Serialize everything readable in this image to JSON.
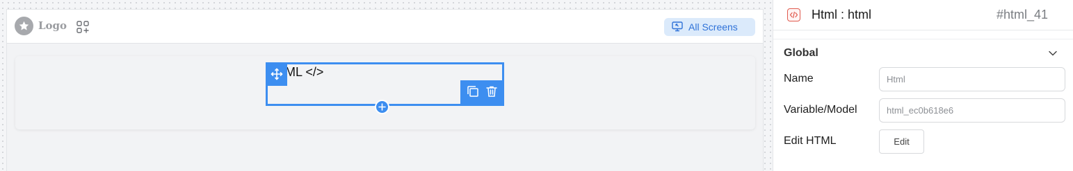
{
  "canvas": {
    "logo_text": "Logo",
    "all_screens_label": "All Screens",
    "html_element_text": "ML </>"
  },
  "panel": {
    "title": "Html : html",
    "component_id": "#html_41",
    "section_title": "Global",
    "fields": {
      "name_label": "Name",
      "name_placeholder": "Html",
      "variable_label": "Variable/Model",
      "variable_placeholder": "html_ec0b618e6",
      "edit_html_label": "Edit HTML",
      "edit_button_label": "Edit"
    }
  },
  "colors": {
    "accent": "#3d8ef0",
    "chip_bg": "#dbeafb",
    "chip_text": "#2f72d8",
    "component_icon": "#e05a4e"
  },
  "icons": {
    "logo": "star-icon",
    "apps": "apps-add-icon",
    "screens": "screen-icon",
    "move": "move-icon",
    "duplicate": "copy-icon",
    "delete": "trash-icon",
    "add": "plus-icon",
    "component": "code-icon",
    "collapse": "chevron-down-icon"
  }
}
